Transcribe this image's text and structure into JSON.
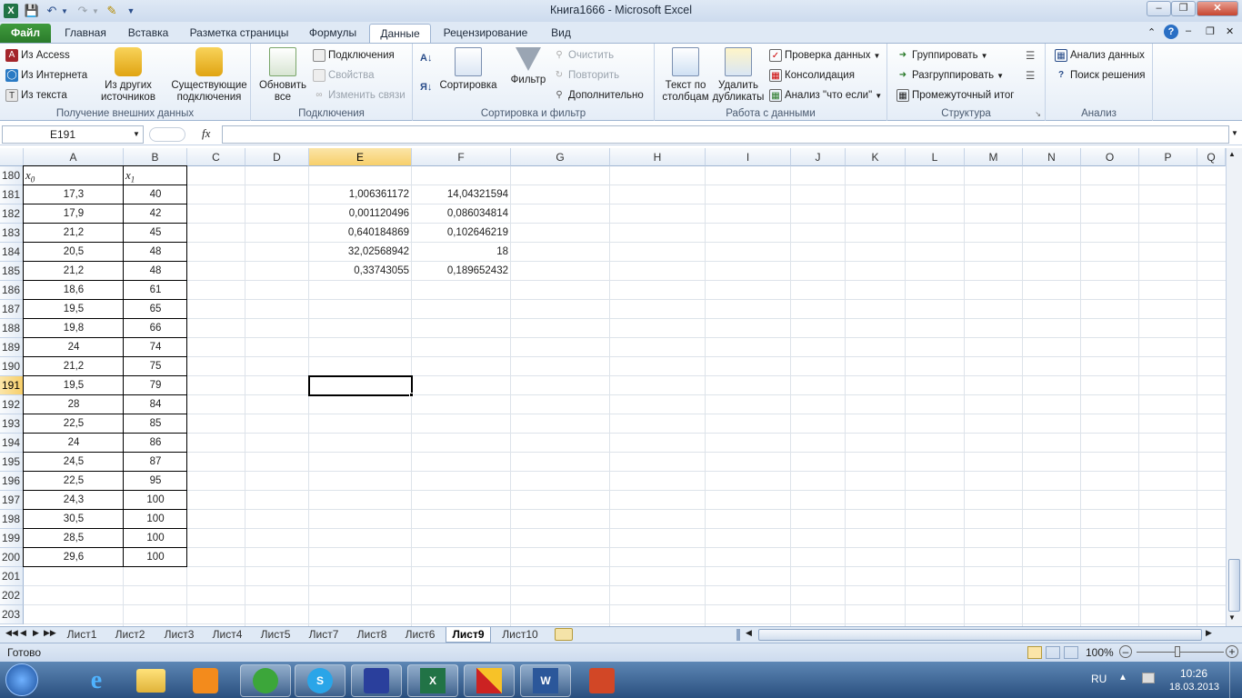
{
  "window": {
    "title": "Книга1666  -  Microsoft Excel"
  },
  "tabs": [
    "Файл",
    "Главная",
    "Вставка",
    "Разметка страницы",
    "Формулы",
    "Данные",
    "Рецензирование",
    "Вид"
  ],
  "ribbon": {
    "ext": {
      "access": "Из Access",
      "internet": "Из Интернета",
      "text": "Из текста",
      "other": "Из других источников",
      "existing": "Существующие подключения",
      "label": "Получение внешних данных"
    },
    "conn": {
      "refresh": "Обновить все",
      "connections": "Подключения",
      "properties": "Свойства",
      "links": "Изменить связи",
      "label": "Подключения"
    },
    "sort": {
      "sort": "Сортировка",
      "filter": "Фильтр",
      "clear": "Очистить",
      "reapply": "Повторить",
      "advanced": "Дополнительно",
      "label": "Сортировка и фильтр"
    },
    "tools": {
      "text_to_cols": "Текст по столбцам",
      "remove_dup": "Удалить дубликаты",
      "validation": "Проверка данных",
      "consolidate": "Консолидация",
      "whatif": "Анализ \"что если\"",
      "label": "Работа с данными"
    },
    "outline": {
      "group": "Группировать",
      "ungroup": "Разгруппировать",
      "subtotal": "Промежуточный итог",
      "label": "Структура"
    },
    "analysis": {
      "data_analysis": "Анализ данных",
      "solver": "Поиск решения",
      "label": "Анализ"
    }
  },
  "formula_bar": {
    "namebox": "E191",
    "fx": "fx",
    "value": ""
  },
  "columns": [
    "A",
    "B",
    "C",
    "D",
    "E",
    "F",
    "G",
    "H",
    "I",
    "J",
    "K",
    "L",
    "M",
    "N",
    "O",
    "P",
    "Q"
  ],
  "rows": [
    "180",
    "181",
    "182",
    "183",
    "184",
    "185",
    "186",
    "187",
    "188",
    "189",
    "190",
    "191",
    "192",
    "193",
    "194",
    "195",
    "196",
    "197",
    "198",
    "199",
    "200",
    "201",
    "202",
    "203"
  ],
  "header_row": {
    "a": "x",
    "a_sub": "0",
    "b": "x",
    "b_sub": "1"
  },
  "table_a": [
    "17,3",
    "17,9",
    "21,2",
    "20,5",
    "21,2",
    "18,6",
    "19,5",
    "19,8",
    "24",
    "21,2",
    "19,5",
    "28",
    "22,5",
    "24",
    "24,5",
    "22,5",
    "24,3",
    "30,5",
    "28,5",
    "29,6"
  ],
  "table_b": [
    "40",
    "42",
    "45",
    "48",
    "48",
    "61",
    "65",
    "66",
    "74",
    "75",
    "79",
    "84",
    "85",
    "86",
    "87",
    "95",
    "100",
    "100",
    "100",
    "100"
  ],
  "table_e": [
    "1,006361172",
    "0,001120496",
    "0,640184869",
    "32,02568942",
    "0,33743055"
  ],
  "table_f": [
    "14,04321594",
    "0,086034814",
    "0,102646219",
    "18",
    "0,189652432"
  ],
  "sheets": [
    "Лист1",
    "Лист2",
    "Лист3",
    "Лист4",
    "Лист5",
    "Лист7",
    "Лист8",
    "Лист6",
    "Лист9",
    "Лист10"
  ],
  "active_sheet": "Лист9",
  "status": {
    "ready": "Готово",
    "zoom": "100%"
  },
  "tray": {
    "lang": "RU",
    "time": "10:26",
    "date": "18.03.2013"
  }
}
